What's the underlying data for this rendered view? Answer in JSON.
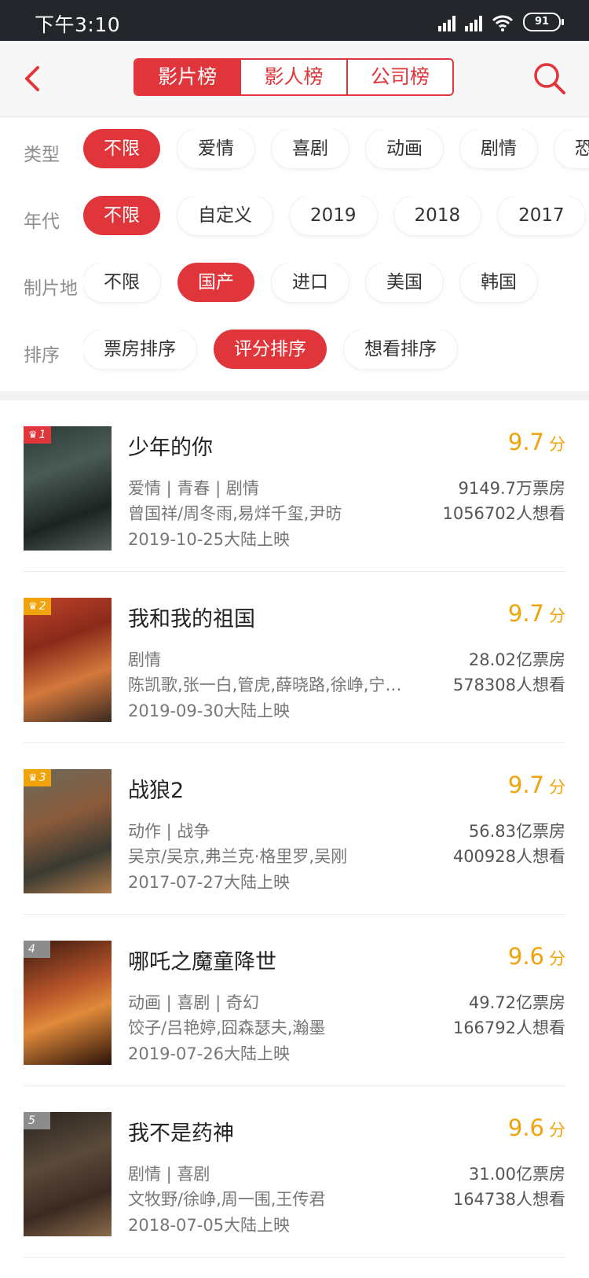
{
  "status": {
    "time": "下午3:10",
    "battery": "91"
  },
  "nav": {
    "back_icon": "back-arrow-icon",
    "search_icon": "search-icon",
    "tabs": [
      {
        "label": "影片榜",
        "active": true
      },
      {
        "label": "影人榜",
        "active": false
      },
      {
        "label": "公司榜",
        "active": false
      }
    ],
    "accent": "#e0353a"
  },
  "filters": [
    {
      "label": "类型",
      "options": [
        "不限",
        "爱情",
        "喜剧",
        "动画",
        "剧情",
        "恐"
      ],
      "selected": 0
    },
    {
      "label": "年代",
      "options": [
        "不限",
        "自定义",
        "2019",
        "2018",
        "2017"
      ],
      "selected": 0
    },
    {
      "label": "制片地",
      "options": [
        "不限",
        "国产",
        "进口",
        "美国",
        "韩国"
      ],
      "selected": 1
    },
    {
      "label": "排序",
      "options": [
        "票房排序",
        "评分排序",
        "想看排序"
      ],
      "selected": 1
    }
  ],
  "movies": [
    {
      "rank": "1",
      "title": "少年的你",
      "score": "9.7",
      "score_unit": "分",
      "genre": "爱情 | 青春 | 剧情",
      "cast": "曾国祥/周冬雨,易烊千玺,尹昉",
      "date": "2019-10-25大陆上映",
      "box_office": "9149.7万票房",
      "want": "1056702人想看"
    },
    {
      "rank": "2",
      "title": "我和我的祖国",
      "score": "9.7",
      "score_unit": "分",
      "genre": "剧情",
      "cast": "陈凯歌,张一白,管虎,薛晓路,徐峥,宁…",
      "date": "2019-09-30大陆上映",
      "box_office": "28.02亿票房",
      "want": "578308人想看"
    },
    {
      "rank": "3",
      "title": "战狼2",
      "score": "9.7",
      "score_unit": "分",
      "genre": "动作 | 战争",
      "cast": "吴京/吴京,弗兰克·格里罗,吴刚",
      "date": "2017-07-27大陆上映",
      "box_office": "56.83亿票房",
      "want": "400928人想看"
    },
    {
      "rank": "4",
      "title": "哪吒之魔童降世",
      "score": "9.6",
      "score_unit": "分",
      "genre": "动画 | 喜剧 | 奇幻",
      "cast": "饺子/吕艳婷,囧森瑟夫,瀚墨",
      "date": "2019-07-26大陆上映",
      "box_office": "49.72亿票房",
      "want": "166792人想看"
    },
    {
      "rank": "5",
      "title": "我不是药神",
      "score": "9.6",
      "score_unit": "分",
      "genre": "剧情 | 喜剧",
      "cast": "文牧野/徐峥,周一围,王传君",
      "date": "2018-07-05大陆上映",
      "box_office": "31.00亿票房",
      "want": "164738人想看"
    }
  ],
  "colors": {
    "accent": "#e0353a",
    "score": "#f0a30a",
    "rank1": "#e0353a",
    "rank2": "#f0a30a",
    "rank3": "#f0a30a",
    "rank_other": "#8c8c8c"
  }
}
